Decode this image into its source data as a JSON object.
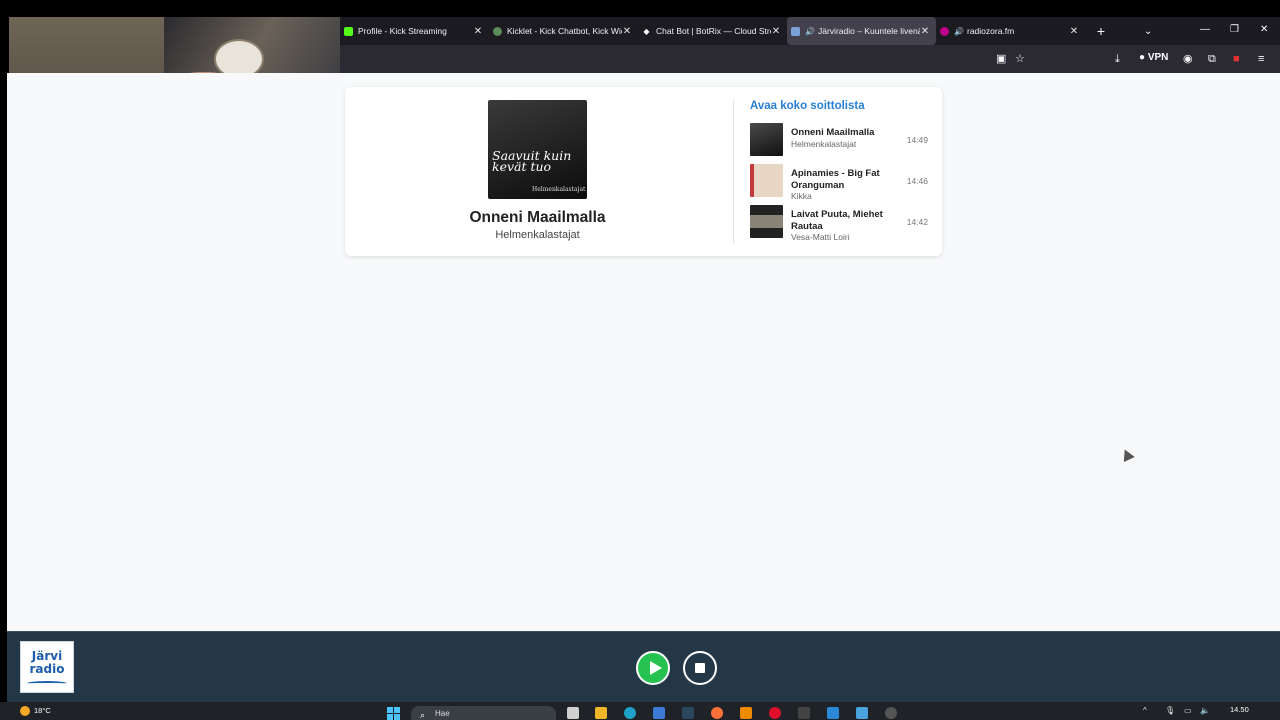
{
  "browser": {
    "tabs": [
      {
        "title": "Profile - Kick Streaming",
        "icon": "kick-icon",
        "color": "#53fc18",
        "active": false
      },
      {
        "title": "Kicklet - Kick Chatbot, Kick Widg",
        "icon": "kicklet-icon",
        "color": "#5b8c5a",
        "active": false
      },
      {
        "title": "Chat Bot | BotRix — Cloud Strea",
        "icon": "botrix-icon",
        "color": "#ffffff",
        "active": false
      },
      {
        "title": "Järviradio – Kuuntele livenä",
        "icon": "jarviradio-icon",
        "color": "#7aa0d8",
        "active": true
      },
      {
        "title": "radiozora.fm",
        "icon": "radiozora-icon",
        "color": "#c0008a",
        "active": false
      }
    ],
    "vpn_label": "VPN"
  },
  "now_playing": {
    "cover_text": "Saavuit kuin kevät tuo",
    "cover_artist": "Helmenkalastajat",
    "title": "Onneni Maailmalla",
    "artist": "Helmenkalastajat"
  },
  "playlist": {
    "link_label": "Avaa koko soittolista",
    "items": [
      {
        "title": "Onneni Maailmalla",
        "artist": "Helmenkalastajat",
        "time": "14:49",
        "thumb": "#2b2b2b"
      },
      {
        "title": "Apinamies - Big Fat Oranguman",
        "artist": "Kikka",
        "time": "14:46",
        "thumb": "#d9b7a0"
      },
      {
        "title": "Laivat Puuta, Miehet Rautaa",
        "artist": "Vesa-Matti Loiri",
        "time": "14:42",
        "thumb": "#1a1a1a"
      }
    ]
  },
  "player": {
    "logo_text": "Järvi radio"
  },
  "taskbar": {
    "temperature": "18°C",
    "search_placeholder": "Hae",
    "time": "14.50"
  }
}
